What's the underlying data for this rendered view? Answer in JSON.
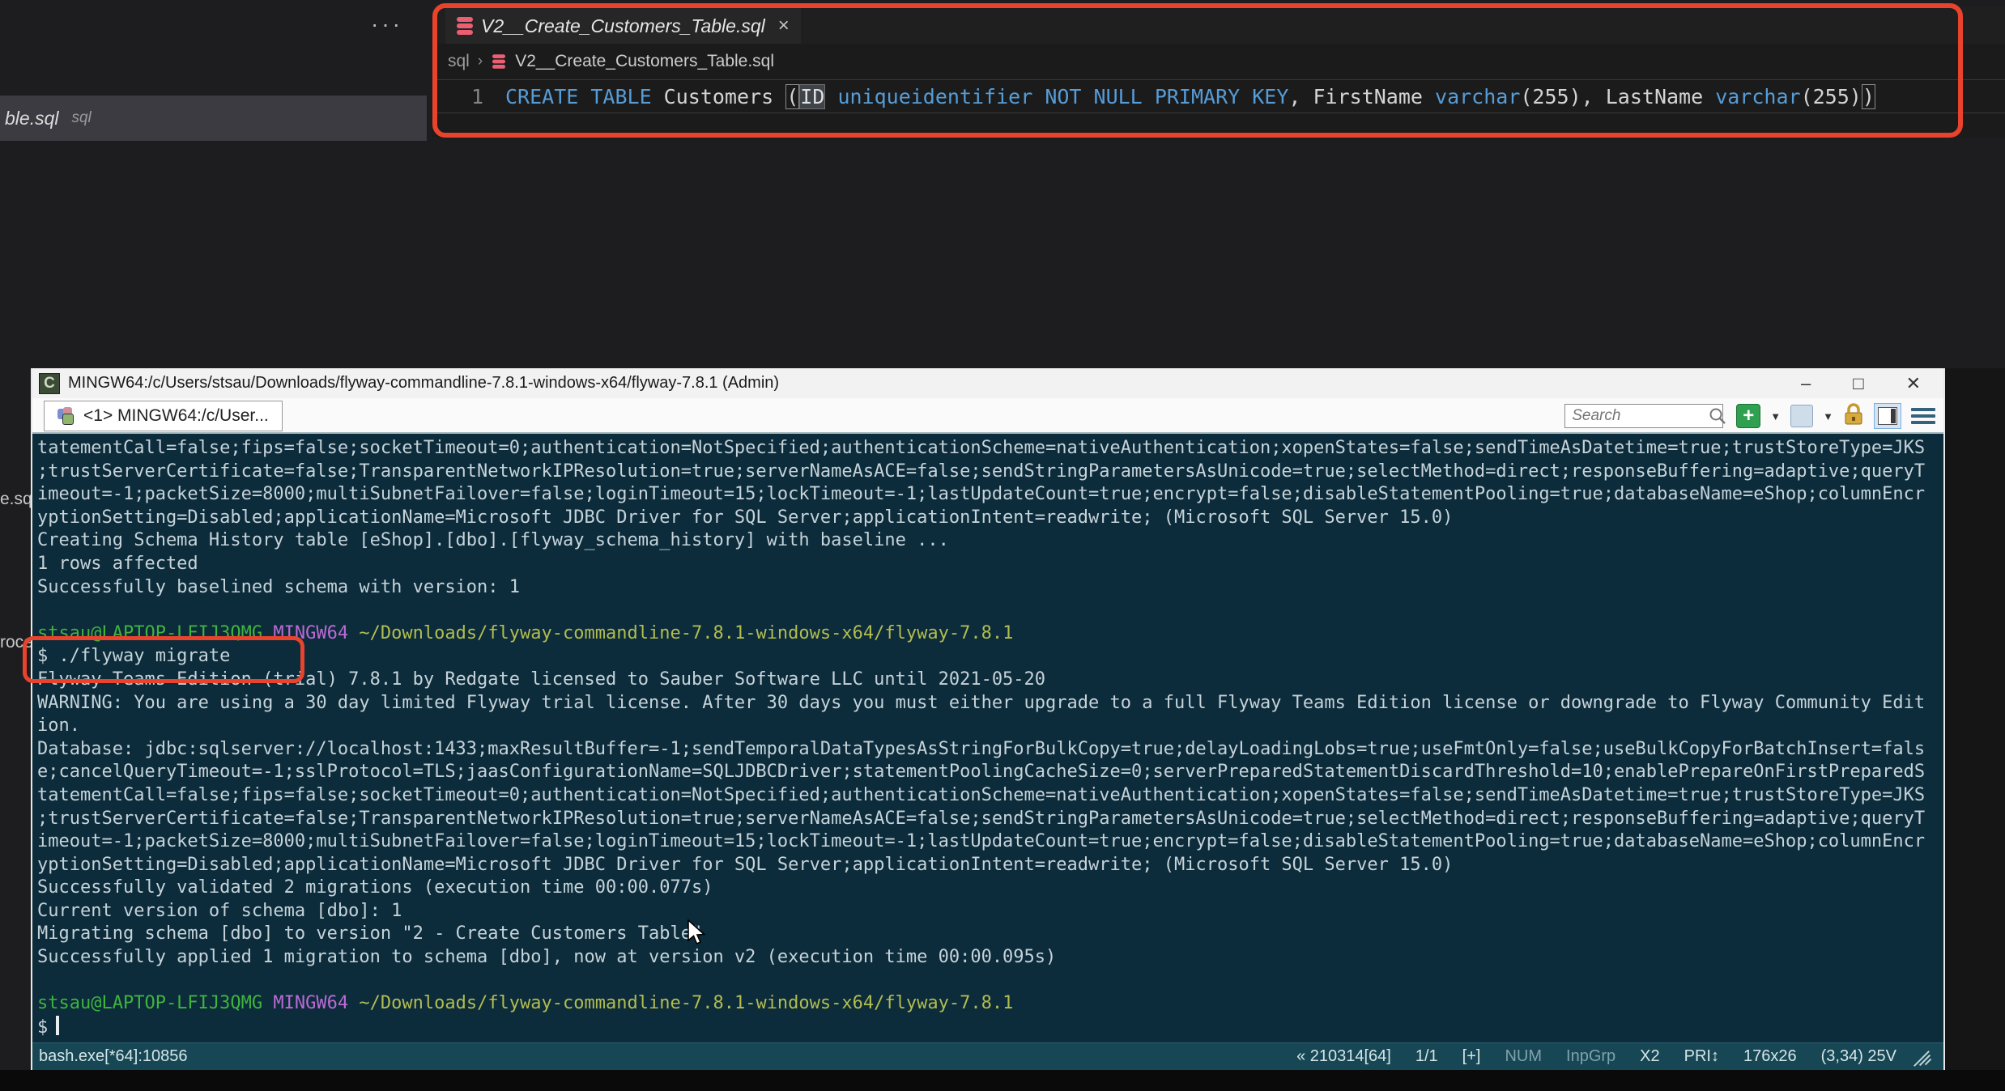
{
  "colors": {
    "annotation_red": "#e8432c",
    "keyword_blue": "#569cd6",
    "terminal_bg": "#0c2b3b",
    "statusbar_bg": "#174754",
    "prompt_green": "#3fb43f",
    "prompt_purple": "#bb6ad4",
    "prompt_path_yellow": "#b2bd50"
  },
  "editor": {
    "more_actions_label": "···",
    "background_item": {
      "filename": "ble.sql",
      "detail": "sql"
    },
    "left_fragments": [
      "e.sq",
      "roce"
    ],
    "tab": {
      "title": "V2__Create_Customers_Table.sql",
      "close_label": "×",
      "icon": "database"
    },
    "breadcrumb": {
      "folder": "sql",
      "separator": "›",
      "file": "V2__Create_Customers_Table.sql"
    },
    "code": {
      "line_number": "1",
      "tokens": [
        {
          "t": "CREATE TABLE",
          "c": "kw"
        },
        {
          "t": " Customers ",
          "c": "id"
        },
        {
          "t": "(",
          "c": "bracket"
        },
        {
          "t": "ID",
          "c": "idsel"
        },
        {
          "t": " ",
          "c": "id"
        },
        {
          "t": "uniqueidentifier",
          "c": "kw"
        },
        {
          "t": " ",
          "c": "id"
        },
        {
          "t": "NOT NULL",
          "c": "kw"
        },
        {
          "t": " ",
          "c": "id"
        },
        {
          "t": "PRIMARY KEY",
          "c": "kw"
        },
        {
          "t": ", FirstName ",
          "c": "id"
        },
        {
          "t": "varchar",
          "c": "kw"
        },
        {
          "t": "(255), LastName ",
          "c": "id"
        },
        {
          "t": "varchar",
          "c": "kw"
        },
        {
          "t": "(255)",
          "c": "id"
        },
        {
          "t": ")",
          "c": "bracket"
        }
      ]
    }
  },
  "terminal": {
    "title": "MINGW64:/c/Users/stsau/Downloads/flyway-commandline-7.8.1-windows-x64/flyway-7.8.1 (Admin)",
    "window_controls": {
      "minimize": "–",
      "maximize": "□",
      "close": "✕"
    },
    "tab_label": "<1> MINGW64:/c/User...",
    "search_placeholder": "Search",
    "new_console_label": "+",
    "dropdown_glyph": "▼",
    "lock_glyph": "lock",
    "prompt": {
      "user": "stsau@LAPTOP-LFIJ3QMG",
      "env": "MINGW64",
      "path": "~/Downloads/flyway-commandline-7.8.1-windows-x64/flyway-7.8.1"
    },
    "lines": [
      {
        "type": "plain",
        "text": "tatementCall=false;fips=false;socketTimeout=0;authentication=NotSpecified;authenticationScheme=nativeAuthentication;xopenStates=false;sendTimeAsDatetime=true;trustStoreType=JKS"
      },
      {
        "type": "plain",
        "text": ";trustServerCertificate=false;TransparentNetworkIPResolution=true;serverNameAsACE=false;sendStringParametersAsUnicode=true;selectMethod=direct;responseBuffering=adaptive;queryT"
      },
      {
        "type": "plain",
        "text": "imeout=-1;packetSize=8000;multiSubnetFailover=false;loginTimeout=15;lockTimeout=-1;lastUpdateCount=true;encrypt=false;disableStatementPooling=true;databaseName=eShop;columnEncr"
      },
      {
        "type": "plain",
        "text": "yptionSetting=Disabled;applicationName=Microsoft JDBC Driver for SQL Server;applicationIntent=readwrite; (Microsoft SQL Server 15.0)"
      },
      {
        "type": "plain",
        "text": "Creating Schema History table [eShop].[dbo].[flyway_schema_history] with baseline ..."
      },
      {
        "type": "plain",
        "text": "1 rows affected"
      },
      {
        "type": "plain",
        "text": "Successfully baselined schema with version: 1"
      },
      {
        "type": "plain",
        "text": ""
      },
      {
        "type": "prompt"
      },
      {
        "type": "command",
        "text": "$ ./flyway migrate"
      },
      {
        "type": "plain",
        "text": "Flyway Teams Edition (trial) 7.8.1 by Redgate licensed to Sauber Software LLC until 2021-05-20"
      },
      {
        "type": "plain",
        "text": "WARNING: You are using a 30 day limited Flyway trial license. After 30 days you must either upgrade to a full Flyway Teams Edition license or downgrade to Flyway Community Edit"
      },
      {
        "type": "plain",
        "text": "ion."
      },
      {
        "type": "plain",
        "text": "Database: jdbc:sqlserver://localhost:1433;maxResultBuffer=-1;sendTemporalDataTypesAsStringForBulkCopy=true;delayLoadingLobs=true;useFmtOnly=false;useBulkCopyForBatchInsert=fals"
      },
      {
        "type": "plain",
        "text": "e;cancelQueryTimeout=-1;sslProtocol=TLS;jaasConfigurationName=SQLJDBCDriver;statementPoolingCacheSize=0;serverPreparedStatementDiscardThreshold=10;enablePrepareOnFirstPreparedS"
      },
      {
        "type": "plain",
        "text": "tatementCall=false;fips=false;socketTimeout=0;authentication=NotSpecified;authenticationScheme=nativeAuthentication;xopenStates=false;sendTimeAsDatetime=true;trustStoreType=JKS"
      },
      {
        "type": "plain",
        "text": ";trustServerCertificate=false;TransparentNetworkIPResolution=true;serverNameAsACE=false;sendStringParametersAsUnicode=true;selectMethod=direct;responseBuffering=adaptive;queryT"
      },
      {
        "type": "plain",
        "text": "imeout=-1;packetSize=8000;multiSubnetFailover=false;loginTimeout=15;lockTimeout=-1;lastUpdateCount=true;encrypt=false;disableStatementPooling=true;databaseName=eShop;columnEncr"
      },
      {
        "type": "plain",
        "text": "yptionSetting=Disabled;applicationName=Microsoft JDBC Driver for SQL Server;applicationIntent=readwrite; (Microsoft SQL Server 15.0)"
      },
      {
        "type": "plain",
        "text": "Successfully validated 2 migrations (execution time 00:00.077s)"
      },
      {
        "type": "plain",
        "text": "Current version of schema [dbo]: 1"
      },
      {
        "type": "plain",
        "text": "Migrating schema [dbo] to version \"2 - Create Customers Table\""
      },
      {
        "type": "plain",
        "text": "Successfully applied 1 migration to schema [dbo], now at version v2 (execution time 00:00.095s)"
      },
      {
        "type": "plain",
        "text": ""
      },
      {
        "type": "prompt"
      },
      {
        "type": "cursor",
        "text": "$"
      }
    ],
    "statusbar": {
      "left": "bash.exe[*64]:10856",
      "right_items": [
        {
          "label": "« 210314[64]",
          "dim": false
        },
        {
          "label": "1/1",
          "dim": false
        },
        {
          "label": "[+]",
          "dim": false
        },
        {
          "label": "NUM",
          "dim": true
        },
        {
          "label": "InpGrp",
          "dim": true
        },
        {
          "label": "X2",
          "dim": false
        },
        {
          "label": "PRI↕",
          "dim": false
        },
        {
          "label": "176x26",
          "dim": false
        },
        {
          "label": "(3,34) 25V",
          "dim": false
        }
      ]
    }
  }
}
